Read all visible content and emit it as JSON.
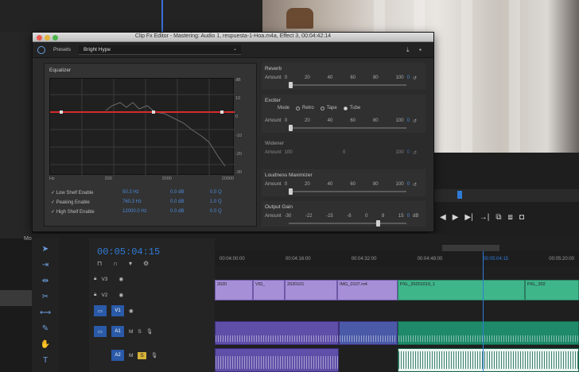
{
  "app": {
    "title": "Clip Fx Editor - Mastering: Audio 1, respuesta-1-Hoa.m4a, Effect 3, 00:04:42:14"
  },
  "presets": {
    "label": "Presets",
    "value": "Bright Hype"
  },
  "equalizer": {
    "title": "Equalizer",
    "db_ticks": [
      "dB",
      "10",
      "0",
      "-10",
      "-20",
      "-30"
    ],
    "freq_ticks": [
      "Hz",
      "200",
      "2000",
      "20000"
    ],
    "bands": [
      {
        "name": "Low Shelf Enable",
        "freq": "50.3 Hz",
        "gain": "0.0 dB",
        "q": "0.0 Q"
      },
      {
        "name": "Peaking Enable",
        "freq": "760.3 Hz",
        "gain": "0.0 dB",
        "q": "1.0 Q"
      },
      {
        "name": "High Shelf Enable",
        "freq": "12000.0 Hz",
        "gain": "0.0 dB",
        "q": "0.0 Q"
      }
    ]
  },
  "reverb": {
    "title": "Reverb",
    "amount_label": "Amount",
    "scale": [
      "0",
      "20",
      "40",
      "60",
      "80",
      "100"
    ],
    "value": "0"
  },
  "exciter": {
    "title": "Exciter",
    "mode_label": "Mode",
    "modes": [
      "Retro",
      "Tape",
      "Tube"
    ],
    "active_mode": "Tube",
    "amount_label": "Amount",
    "scale": [
      "0",
      "20",
      "40",
      "60",
      "80",
      "100"
    ],
    "value": "0"
  },
  "widener": {
    "title": "Widener",
    "amount_label": "Amount",
    "scale": [
      "100",
      "0",
      "100"
    ],
    "value": "0"
  },
  "loudness": {
    "title": "Loudness Maximizer",
    "amount_label": "Amount",
    "scale": [
      "0",
      "20",
      "40",
      "60",
      "80",
      "100"
    ],
    "value": "0"
  },
  "output_gain": {
    "title": "Output Gain",
    "amount_label": "Amount",
    "scale": [
      "-30",
      "-22",
      "-15",
      "-8",
      "0",
      "8",
      "15"
    ],
    "value": "0",
    "unit": "dB"
  },
  "timeline": {
    "timecode": "00:05:04:15",
    "ruler": [
      "00:04:00:00",
      "00:04:16:00",
      "00:04:32:00",
      "00:04:48:00",
      "00:05:04:15",
      "00:05:20:00"
    ],
    "tracks": [
      {
        "id": "V3"
      },
      {
        "id": "V2"
      },
      {
        "id": "V1"
      },
      {
        "id": "A1"
      },
      {
        "id": "A2"
      }
    ],
    "video_clips": [
      {
        "label": "2020",
        "color": "purple"
      },
      {
        "label": "VID_",
        "color": "purple"
      },
      {
        "label": "2020101",
        "color": "purple"
      },
      {
        "label": "IMG_0107.m4",
        "color": "purple"
      },
      {
        "label": "PXL_20201019_1",
        "color": "green"
      },
      {
        "label": "PXL_202",
        "color": "green"
      }
    ]
  },
  "left_panel": {
    "label": "Mo"
  },
  "colors": {
    "accent": "#2f7bd6",
    "eq_line": "#d62b2b",
    "clip_video": "#a78fd8",
    "clip_green": "#3fb58a"
  }
}
